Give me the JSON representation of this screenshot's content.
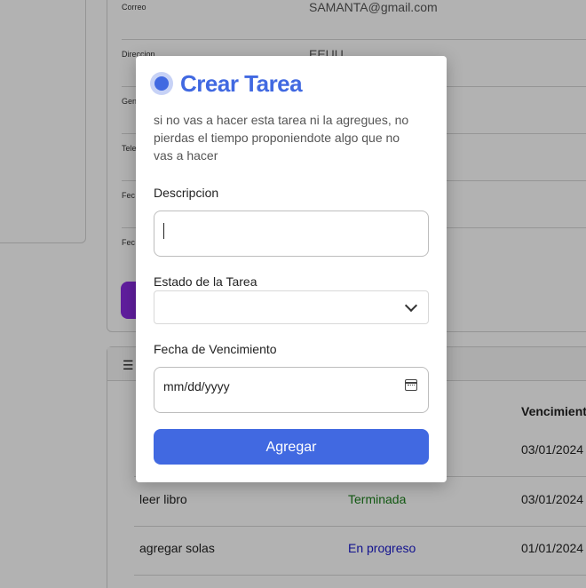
{
  "profile": {
    "rows": [
      {
        "label": "Correo",
        "value": "SAMANTA@gmail.com"
      },
      {
        "label": "Direccion",
        "value": "EEUU"
      },
      {
        "label": "Gen",
        "value": ""
      },
      {
        "label": "Tele",
        "value": ""
      },
      {
        "label": "Fec",
        "value": ""
      },
      {
        "label": "Fec",
        "value": ""
      }
    ]
  },
  "tasks": {
    "header_icon": "list-icon",
    "column_due": "Vencimient",
    "rows": [
      {
        "name": "",
        "status": "",
        "date": "03/01/2024",
        "status_color": "#1a7f1a"
      },
      {
        "name": "leer libro",
        "status": "Terminada",
        "date": "03/01/2024",
        "status_color": "#1a7f1a"
      },
      {
        "name": "agregar solas",
        "status": "En progreso",
        "date": "01/01/2024",
        "status_color": "#1a1acc"
      }
    ]
  },
  "modal": {
    "title": "Crear Tarea",
    "subtitle": "si no vas a hacer esta tarea ni la agregues, no pierdas el tiempo proponiendote algo que no vas a hacer",
    "description_label": "Descripcion",
    "description_value": "",
    "status_label": "Estado de la Tarea",
    "status_value": "",
    "due_label": "Fecha de Vencimiento",
    "due_placeholder": "mm/dd/yyyy",
    "submit_label": "Agregar"
  },
  "colors": {
    "accent": "#4169e1",
    "accent_soft": "#c7d2f6",
    "overlay": "rgba(0,0,0,0.30)",
    "purple": "#8a2be2"
  }
}
